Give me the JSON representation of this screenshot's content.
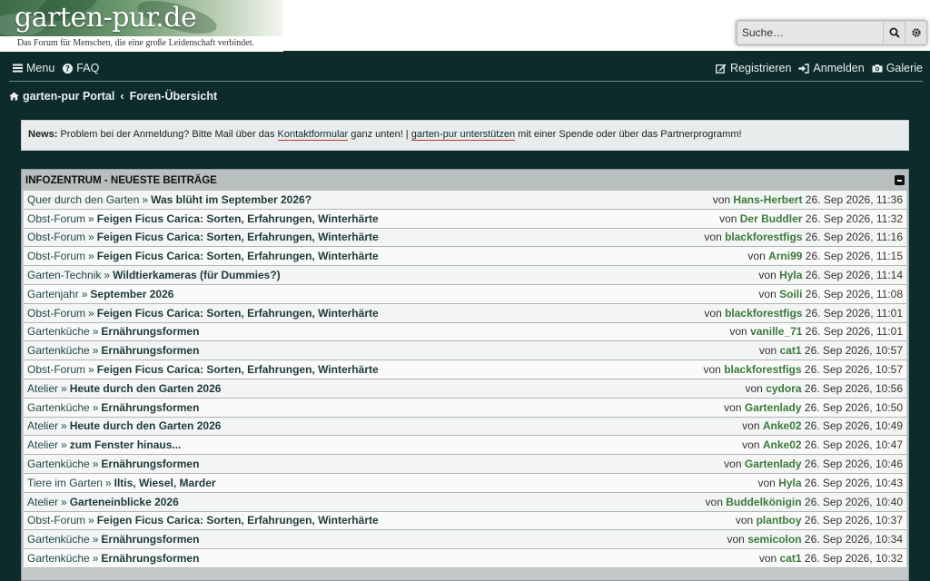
{
  "header": {
    "site_title": "garten-pur.de",
    "tagline": "Das Forum für Menschen, die eine große Leidenschaft verbindet.",
    "search_placeholder": "Suche…"
  },
  "nav": {
    "menu": "Menu",
    "faq": "FAQ",
    "register": "Registrieren",
    "login": "Anmelden",
    "gallery": "Galerie"
  },
  "breadcrumb": {
    "portal": "garten-pur Portal",
    "sep": "‹",
    "overview": "Foren-Übersicht"
  },
  "news": {
    "label": "News:",
    "text1": " Problem bei der Anmeldung? Bitte Mail über das ",
    "link1": "Kontaktformular",
    "text2": " ganz unten! | ",
    "link2": "garten-pur unterstützen",
    "text3": " mit einer Spende oder über das Partnerprogramm!"
  },
  "board": {
    "title": "INFOZENTRUM - NEUESTE BEITRÄGE",
    "by": "von",
    "rows": [
      {
        "forum": "Quer durch den Garten",
        "topic": "Was blüht im September 2026?",
        "user": "Hans-Herbert",
        "date": "26. Sep 2026, 11:36"
      },
      {
        "forum": "Obst-Forum",
        "topic": "Feigen Ficus Carica: Sorten, Erfahrungen, Winterhärte",
        "user": "Der Buddler",
        "date": "26. Sep 2026, 11:32"
      },
      {
        "forum": "Obst-Forum",
        "topic": "Feigen Ficus Carica: Sorten, Erfahrungen, Winterhärte",
        "user": "blackforestfigs",
        "date": "26. Sep 2026, 11:16"
      },
      {
        "forum": "Obst-Forum",
        "topic": "Feigen Ficus Carica: Sorten, Erfahrungen, Winterhärte",
        "user": "Arni99",
        "date": "26. Sep 2026, 11:15"
      },
      {
        "forum": "Garten-Technik",
        "topic": "Wildtierkameras (für Dummies?)",
        "user": "Hyla",
        "date": "26. Sep 2026, 11:14"
      },
      {
        "forum": "Gartenjahr",
        "topic": "September 2026",
        "user": "Soili",
        "date": "26. Sep 2026, 11:08"
      },
      {
        "forum": "Obst-Forum",
        "topic": "Feigen Ficus Carica: Sorten, Erfahrungen, Winterhärte",
        "user": "blackforestfigs",
        "date": "26. Sep 2026, 11:01"
      },
      {
        "forum": "Gartenküche",
        "topic": "Ernährungsformen",
        "user": "vanille_71",
        "date": "26. Sep 2026, 11:01"
      },
      {
        "forum": "Gartenküche",
        "topic": "Ernährungsformen",
        "user": "cat1",
        "date": "26. Sep 2026, 10:57"
      },
      {
        "forum": "Obst-Forum",
        "topic": "Feigen Ficus Carica: Sorten, Erfahrungen, Winterhärte",
        "user": "blackforestfigs",
        "date": "26. Sep 2026, 10:57"
      },
      {
        "forum": "Atelier",
        "topic": "Heute durch den Garten 2026",
        "user": "cydora",
        "date": "26. Sep 2026, 10:56"
      },
      {
        "forum": "Gartenküche",
        "topic": "Ernährungsformen",
        "user": "Gartenlady",
        "date": "26. Sep 2026, 10:50"
      },
      {
        "forum": "Atelier",
        "topic": "Heute durch den Garten 2026",
        "user": "Anke02",
        "date": "26. Sep 2026, 10:49"
      },
      {
        "forum": "Atelier",
        "topic": "zum Fenster hinaus...",
        "user": "Anke02",
        "date": "26. Sep 2026, 10:47"
      },
      {
        "forum": "Gartenküche",
        "topic": "Ernährungsformen",
        "user": "Gartenlady",
        "date": "26. Sep 2026, 10:46"
      },
      {
        "forum": "Tiere im Garten",
        "topic": "Iltis, Wiesel, Marder",
        "user": "Hyla",
        "date": "26. Sep 2026, 10:43"
      },
      {
        "forum": "Atelier",
        "topic": "Garteneinblicke 2026",
        "user": "Buddelkönigin",
        "date": "26. Sep 2026, 10:40"
      },
      {
        "forum": "Obst-Forum",
        "topic": "Feigen Ficus Carica: Sorten, Erfahrungen, Winterhärte",
        "user": "plantboy",
        "date": "26. Sep 2026, 10:37"
      },
      {
        "forum": "Gartenküche",
        "topic": "Ernährungsformen",
        "user": "semicolon",
        "date": "26. Sep 2026, 10:34"
      },
      {
        "forum": "Gartenküche",
        "topic": "Ernährungsformen",
        "user": "cat1",
        "date": "26. Sep 2026, 10:32"
      }
    ]
  },
  "colors": {
    "page_bg": "#0e2b2b",
    "user_link": "#3b7a3b",
    "news_underline": "#c0392b"
  },
  "icons": [
    "search-icon",
    "gear-icon",
    "menu-icon",
    "faq-icon",
    "register-icon",
    "login-icon",
    "gallery-icon",
    "home-icon",
    "collapse-icon"
  ]
}
